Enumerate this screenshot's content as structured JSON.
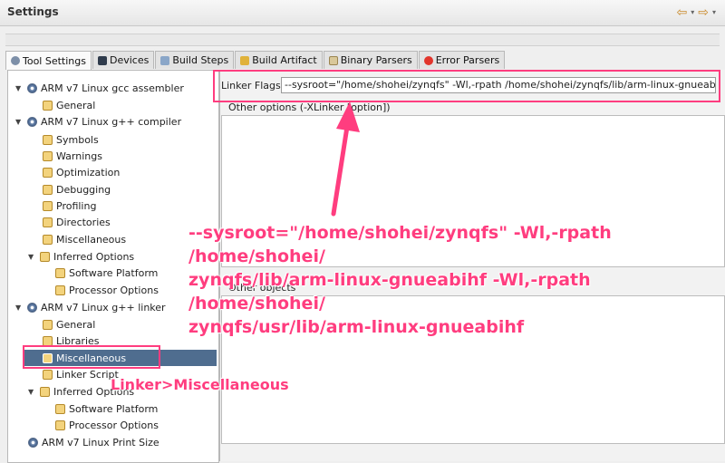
{
  "header": {
    "title": "Settings",
    "nav_back": "⇦",
    "nav_forward": "⇨",
    "nav_dropdown": "▾"
  },
  "colors": {
    "annotation": "#ff3d7f",
    "selection": "#4f6d8f"
  },
  "tabs": [
    {
      "label": "Tool Settings",
      "icon": "tool-settings-icon",
      "active": true
    },
    {
      "label": "Devices",
      "icon": "devices-icon",
      "active": false
    },
    {
      "label": "Build Steps",
      "icon": "build-steps-icon",
      "active": false
    },
    {
      "label": "Build Artifact",
      "icon": "build-artifact-icon",
      "active": false
    },
    {
      "label": "Binary Parsers",
      "icon": "binary-parsers-icon",
      "active": false
    },
    {
      "label": "Error Parsers",
      "icon": "error-parsers-icon",
      "active": false
    }
  ],
  "tree": [
    {
      "label": "ARM v7 Linux gcc assembler",
      "type": "category"
    },
    {
      "label": "General",
      "type": "option"
    },
    {
      "label": "ARM v7 Linux g++ compiler",
      "type": "category"
    },
    {
      "label": "Symbols",
      "type": "option"
    },
    {
      "label": "Warnings",
      "type": "option"
    },
    {
      "label": "Optimization",
      "type": "option"
    },
    {
      "label": "Debugging",
      "type": "option"
    },
    {
      "label": "Profiling",
      "type": "option"
    },
    {
      "label": "Directories",
      "type": "option"
    },
    {
      "label": "Miscellaneous",
      "type": "option"
    },
    {
      "label": "Inferred Options",
      "type": "option"
    },
    {
      "label": "Software Platform",
      "type": "option"
    },
    {
      "label": "Processor Options",
      "type": "option"
    },
    {
      "label": "ARM v7 Linux g++ linker",
      "type": "category"
    },
    {
      "label": "General",
      "type": "option"
    },
    {
      "label": "Libraries",
      "type": "option"
    },
    {
      "label": "Miscellaneous",
      "type": "option",
      "selected": true
    },
    {
      "label": "Linker Script",
      "type": "option"
    },
    {
      "label": "Inferred Options",
      "type": "option"
    },
    {
      "label": "Software Platform",
      "type": "option"
    },
    {
      "label": "Processor Options",
      "type": "option"
    },
    {
      "label": "ARM v7 Linux Print Size",
      "type": "category"
    }
  ],
  "linker": {
    "flags_label": "Linker Flags",
    "flags_value": "--sysroot=\"/home/shohei/zynqfs\" -Wl,-rpath /home/shohei/zynqfs/lib/arm-linux-gnueabihf -Wl,-rpath /home/shohei/zynqfs/usr/lib/arm-linux-gnueabihf",
    "other_options_label": "Other options (-XLinker [option])",
    "other_objects_label": "Other objects"
  },
  "annotation": {
    "flags_line1": "--sysroot=\"/home/shohei/zynqfs\" -Wl,-rpath /home/shohei/",
    "flags_line2": "zynqfs/lib/arm-linux-gnueabihf -Wl,-rpath /home/shohei/",
    "flags_line3": "zynqfs/usr/lib/arm-linux-gnueabihf",
    "linker_path": "Linker>Miscellaneous"
  }
}
